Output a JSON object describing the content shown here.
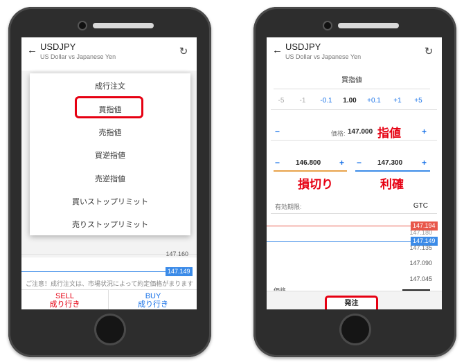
{
  "left": {
    "header": {
      "pair": "USDJPY",
      "pair_sub": "US Dollar vs Japanese Yen"
    },
    "menu": {
      "items": [
        {
          "label": "成行注文"
        },
        {
          "label": "買指値"
        },
        {
          "label": "売指値"
        },
        {
          "label": "買逆指値"
        },
        {
          "label": "売逆指値"
        },
        {
          "label": "買いストップリミット"
        },
        {
          "label": "売りストップリミット"
        }
      ],
      "highlighted_index": 1
    },
    "chart": {
      "price_1": "147.160",
      "price_2": "147.149"
    },
    "notice": "ご注意！成行注文は、市場状況によって約定価格がまります",
    "sell": {
      "label": "SELL",
      "sub": "成り行き"
    },
    "buy": {
      "label": "BUY",
      "sub": "成り行き"
    }
  },
  "right": {
    "header": {
      "pair": "USDJPY",
      "pair_sub": "US Dollar vs Japanese Yen"
    },
    "order_type": "買指値",
    "steps": [
      "-5",
      "-1",
      "-0.1",
      "1.00",
      "+0.1",
      "+1",
      "+5"
    ],
    "price": {
      "minus": "−",
      "label": "価格:",
      "value": "147.000",
      "plus": "+",
      "annotation": "指値"
    },
    "stop_loss": {
      "minus": "−",
      "value": "146.800",
      "plus": "+",
      "annotation": "損切り"
    },
    "take_profit": {
      "minus": "−",
      "value": "147.300",
      "plus": "+",
      "annotation": "利確"
    },
    "validity": {
      "label": "有効期限:",
      "value": "GTC"
    },
    "chart": {
      "price_red": "147.194",
      "price_1": "147.180",
      "price_blue": "147.149",
      "price_2": "147.135",
      "price_3": "147.090",
      "price_4": "147.045",
      "bottom_label": "価格"
    },
    "submit_label": "発注"
  },
  "colors": {
    "sell": "#e60012",
    "buy": "#1a73e8",
    "highlight": "#e60012",
    "ask_line": "#e8574a",
    "bid_line": "#3b8be8"
  }
}
